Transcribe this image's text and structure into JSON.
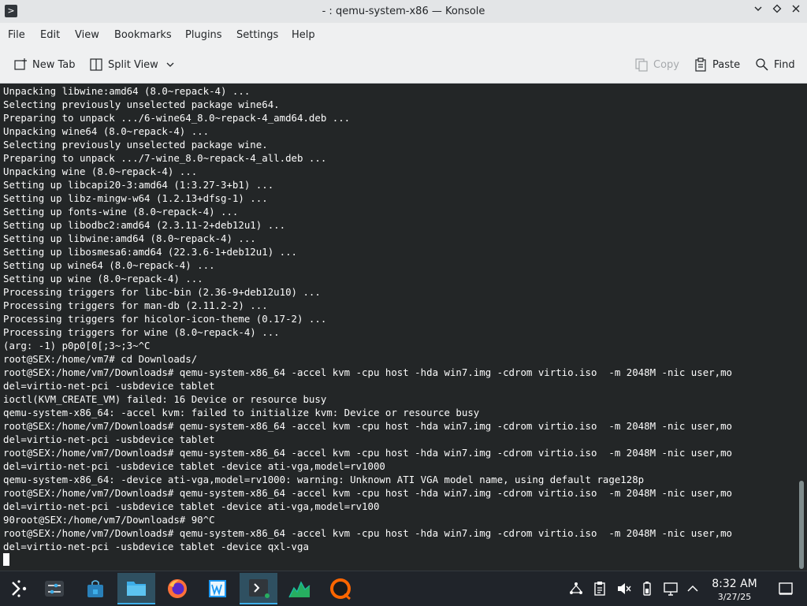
{
  "window": {
    "title": "- : qemu-system-x86 — Konsole"
  },
  "menu": [
    "File",
    "Edit",
    "View",
    "Bookmarks",
    "Plugins",
    "Settings",
    "Help"
  ],
  "toolbar": {
    "new_tab": "New Tab",
    "split_view": "Split View",
    "copy": "Copy",
    "paste": "Paste",
    "find": "Find"
  },
  "terminal": {
    "lines": [
      "Unpacking libwine:amd64 (8.0~repack-4) ...",
      "Selecting previously unselected package wine64.",
      "Preparing to unpack .../6-wine64_8.0~repack-4_amd64.deb ...",
      "Unpacking wine64 (8.0~repack-4) ...",
      "Selecting previously unselected package wine.",
      "Preparing to unpack .../7-wine_8.0~repack-4_all.deb ...",
      "Unpacking wine (8.0~repack-4) ...",
      "Setting up libcapi20-3:amd64 (1:3.27-3+b1) ...",
      "Setting up libz-mingw-w64 (1.2.13+dfsg-1) ...",
      "Setting up fonts-wine (8.0~repack-4) ...",
      "Setting up libodbc2:amd64 (2.3.11-2+deb12u1) ...",
      "Setting up libwine:amd64 (8.0~repack-4) ...",
      "Setting up libosmesa6:amd64 (22.3.6-1+deb12u1) ...",
      "Setting up wine64 (8.0~repack-4) ...",
      "Setting up wine (8.0~repack-4) ...",
      "Processing triggers for libc-bin (2.36-9+deb12u10) ...",
      "Processing triggers for man-db (2.11.2-2) ...",
      "Processing triggers for hicolor-icon-theme (0.17-2) ...",
      "Processing triggers for wine (8.0~repack-4) ...",
      "(arg: -1) p0p0[0[;3~;3~^C",
      "root@SEX:/home/vm7# cd Downloads/",
      "root@SEX:/home/vm7/Downloads# qemu-system-x86_64 -accel kvm -cpu host -hda win7.img -cdrom virtio.iso  -m 2048M -nic user,mo",
      "del=virtio-net-pci -usbdevice tablet",
      "ioctl(KVM_CREATE_VM) failed: 16 Device or resource busy",
      "qemu-system-x86_64: -accel kvm: failed to initialize kvm: Device or resource busy",
      "root@SEX:/home/vm7/Downloads# qemu-system-x86_64 -accel kvm -cpu host -hda win7.img -cdrom virtio.iso  -m 2048M -nic user,mo",
      "del=virtio-net-pci -usbdevice tablet",
      "root@SEX:/home/vm7/Downloads# qemu-system-x86_64 -accel kvm -cpu host -hda win7.img -cdrom virtio.iso  -m 2048M -nic user,mo",
      "del=virtio-net-pci -usbdevice tablet -device ati-vga,model=rv1000",
      "qemu-system-x86_64: -device ati-vga,model=rv1000: warning: Unknown ATI VGA model name, using default rage128p",
      "root@SEX:/home/vm7/Downloads# qemu-system-x86_64 -accel kvm -cpu host -hda win7.img -cdrom virtio.iso  -m 2048M -nic user,mo",
      "del=virtio-net-pci -usbdevice tablet -device ati-vga,model=rv100",
      "90root@SEX:/home/vm7/Downloads# 90^C",
      "root@SEX:/home/vm7/Downloads# qemu-system-x86_64 -accel kvm -cpu host -hda win7.img -cdrom virtio.iso  -m 2048M -nic user,mo",
      "del=virtio-net-pci -usbdevice tablet -device qxl-vga"
    ]
  },
  "taskbar": {
    "apps": [
      "application-launcher",
      "system-settings",
      "discover",
      "file-manager",
      "firefox",
      "text-editor",
      "konsole",
      "system-monitor",
      "qemu"
    ],
    "clock": {
      "time": "8:32 AM",
      "date": "3/27/25"
    }
  },
  "colors": {
    "terminal_bg": "#232627",
    "terminal_fg": "#fcfcfc",
    "taskbar_bg": "#20242a",
    "accent": "#3daee9"
  }
}
